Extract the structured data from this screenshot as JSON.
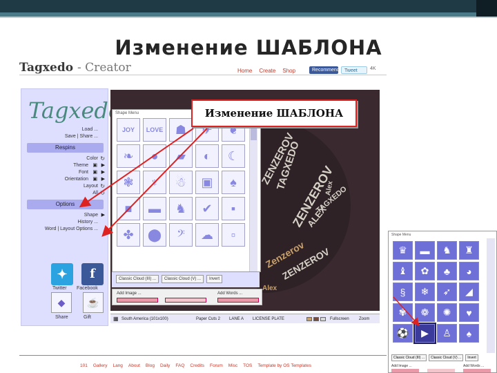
{
  "slide": {
    "title": "Изменение ШАБЛОНА"
  },
  "site": {
    "brand": "Tagxedo",
    "brand_suffix": "- Creator",
    "nav": [
      "Home",
      "Create",
      "Shop"
    ],
    "facebook_button": "Recommend",
    "tweet_button": "Tweet",
    "tweet_count": "4K"
  },
  "sidebar": {
    "logo": "Tagxedo",
    "load": "Load ...",
    "save_share": "Save | Share ...",
    "respins_header": "Respins",
    "respins": [
      "Color",
      "Theme",
      "Font",
      "Orientation",
      "Layout",
      "All"
    ],
    "options_header": "Options",
    "options": [
      "Shape",
      "History ...",
      "Word | Layout Options ..."
    ],
    "social": [
      "Twitter",
      "Facebook",
      "Share",
      "Gift"
    ]
  },
  "shapes_panel": {
    "title": "Shape Menu",
    "text_shapes": [
      "JOY",
      "LOVE"
    ],
    "cloud_buttons": [
      "Classic Cloud (III) ...",
      "Classic Cloud (V) ...",
      "Invert"
    ],
    "add_image": "Add Image ...",
    "add_words": "Add Words ..."
  },
  "status": {
    "shape": "South America (101x100)",
    "font": "Paper Cuts 2",
    "layout": "LANE A",
    "theme": "LICENSE PLATE",
    "fullscreen": "Fullscreen",
    "zoom": "Zoom"
  },
  "cloud_words": [
    "ZENZEROV",
    "TAGXEDO",
    "ALEX",
    "Zenzerov",
    "Alex"
  ],
  "callout": "Изменение ШАБЛОНА",
  "footer": [
    "101",
    "Gallery",
    "Lang",
    "About",
    "Blog",
    "Daily",
    "FAQ",
    "Credits",
    "Forum",
    "Misc",
    "TOS",
    "Template by OS Templates"
  ],
  "inset": {
    "title": "Shape Menu",
    "buttons": [
      "Classic Cloud (III) ...",
      "Classic Cloud (V) ...",
      "Invert"
    ],
    "add_image": "Add Image ...",
    "add_words": "Add Words ..."
  },
  "colors": {
    "accent_red": "#dd2222",
    "sidebar_bg": "#dedeff",
    "header_bar": "#1f3a44"
  }
}
